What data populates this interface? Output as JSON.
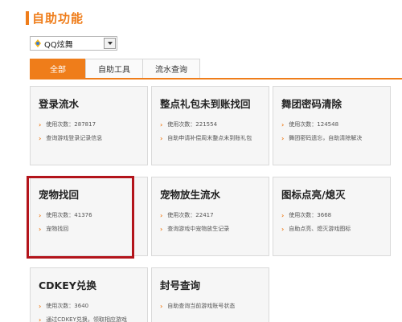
{
  "title": "自助功能",
  "game_select": {
    "value": "QQ炫舞",
    "icon": "qq-dance-game-icon"
  },
  "tabs": [
    {
      "label": "全部",
      "active": true
    },
    {
      "label": "自助工具",
      "active": false
    },
    {
      "label": "流水查询",
      "active": false
    }
  ],
  "cards": [
    {
      "title": "登录流水",
      "usage": "使用次数：287817",
      "desc": "查询游戏登录记录信息"
    },
    {
      "title": "整点礼包未到账找回",
      "usage": "使用次数：221554",
      "desc": "自助申请补偿周末整点未到账礼包"
    },
    {
      "title": "舞团密码清除",
      "usage": "使用次数：124548",
      "desc": "舞团密码遗忘，自助清除解决"
    },
    {
      "title": "宠物找回",
      "usage": "使用次数：41376",
      "desc": "宠物找回"
    },
    {
      "title": "宠物放生流水",
      "usage": "使用次数：22417",
      "desc": "查询游戏中宠物放生记录"
    },
    {
      "title": "图标点亮/熄灭",
      "usage": "使用次数：3668",
      "desc": "自助点亮、熄灭游戏图标"
    },
    {
      "title": "CDKEY兑换",
      "usage": "使用次数：3640",
      "desc": "通过CDKEY兑换，领取相应游戏"
    },
    {
      "title": "封号查询",
      "usage": "",
      "desc": "自助查询当前游戏账号状态"
    }
  ],
  "colors": {
    "accent": "#ef7d1a",
    "highlight_border": "#b3141b"
  }
}
